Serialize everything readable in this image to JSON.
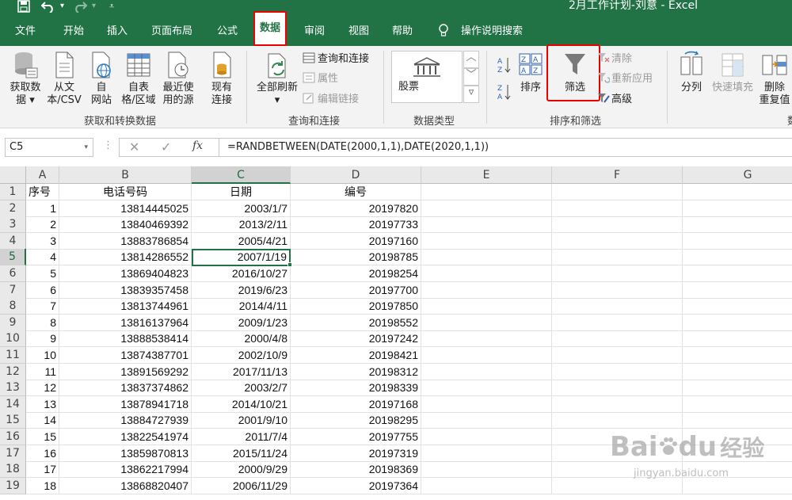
{
  "window": {
    "title": "2月工作计划-刘意 - Excel"
  },
  "qat": {
    "save_icon": "save-icon",
    "undo_icon": "undo-icon",
    "redo_icon": "redo-icon",
    "customize_icon": "customize-qat-icon"
  },
  "tabs": [
    "文件",
    "开始",
    "插入",
    "页面布局",
    "公式",
    "数据",
    "审阅",
    "视图",
    "帮助"
  ],
  "active_tab": "数据",
  "tell_me": "操作说明搜索",
  "ribbon": {
    "get_data": {
      "line1": "获取数",
      "line2": "据 ▾"
    },
    "from_text": {
      "line1": "从文",
      "line2": "本/CSV"
    },
    "from_web": {
      "line1": "自",
      "line2": "网站"
    },
    "from_table": {
      "line1": "自表",
      "line2": "格/区域"
    },
    "recent_sources": {
      "line1": "最近使",
      "line2": "用的源"
    },
    "existing_conn": {
      "line1": "现有",
      "line2": "连接"
    },
    "group_get_transform": "获取和转换数据",
    "refresh_all": {
      "line1": "全部刷新",
      "line2": "▾"
    },
    "queries_connections": "查询和连接",
    "properties": "属性",
    "edit_links": "编辑链接",
    "group_queries": "查询和连接",
    "stocks": "股票",
    "group_data_types": "数据类型",
    "sort": "排序",
    "filter": "筛选",
    "clear": "清除",
    "reapply": "重新应用",
    "advanced": "高级",
    "group_sort_filter": "排序和筛选",
    "text_to_columns": "分列",
    "flash_fill": "快速填充",
    "remove_dup": {
      "line1": "删除",
      "line2": "重复值"
    },
    "group_data_tools_partial": "数"
  },
  "formula_bar": {
    "name_box": "C5",
    "fx": "fx",
    "formula": "=RANDBETWEEN(DATE(2000,1,1),DATE(2020,1,1))"
  },
  "sheet": {
    "columns": [
      "A",
      "B",
      "C",
      "D",
      "E",
      "F",
      "G"
    ],
    "selected_column": "C",
    "selected_row": 5,
    "headers": [
      "序号",
      "电话号码",
      "日期",
      "编号"
    ],
    "rows": [
      [
        "1",
        "13814445025",
        "2003/1/7",
        "20197820"
      ],
      [
        "2",
        "13840469392",
        "2013/2/11",
        "20197733"
      ],
      [
        "3",
        "13883786854",
        "2005/4/21",
        "20197160"
      ],
      [
        "4",
        "13814286552",
        "2007/1/19",
        "20198785"
      ],
      [
        "5",
        "13869404823",
        "2016/10/27",
        "20198254"
      ],
      [
        "6",
        "13839357458",
        "2019/6/23",
        "20197700"
      ],
      [
        "7",
        "13813744961",
        "2014/4/11",
        "20197850"
      ],
      [
        "8",
        "13816137964",
        "2009/1/23",
        "20198552"
      ],
      [
        "9",
        "13888538414",
        "2000/4/8",
        "20197242"
      ],
      [
        "10",
        "13874387701",
        "2002/10/9",
        "20198421"
      ],
      [
        "11",
        "13891569292",
        "2017/11/13",
        "20198312"
      ],
      [
        "12",
        "13837374862",
        "2003/2/7",
        "20198339"
      ],
      [
        "13",
        "13878941718",
        "2014/10/21",
        "20197168"
      ],
      [
        "14",
        "13884727939",
        "2001/9/10",
        "20198295"
      ],
      [
        "15",
        "13822541974",
        "2011/7/4",
        "20197755"
      ],
      [
        "16",
        "13859870813",
        "2015/11/24",
        "20197319"
      ],
      [
        "17",
        "13862217994",
        "2000/9/29",
        "20198369"
      ],
      [
        "18",
        "13868820407",
        "2006/11/29",
        "20197364"
      ]
    ]
  },
  "watermark": {
    "brand": "Bai",
    "brand2": "du",
    "cn": "经验",
    "url": "jingyan.baidu.com"
  },
  "colors": {
    "excel_green": "#217346",
    "highlight_red": "#e00000"
  }
}
